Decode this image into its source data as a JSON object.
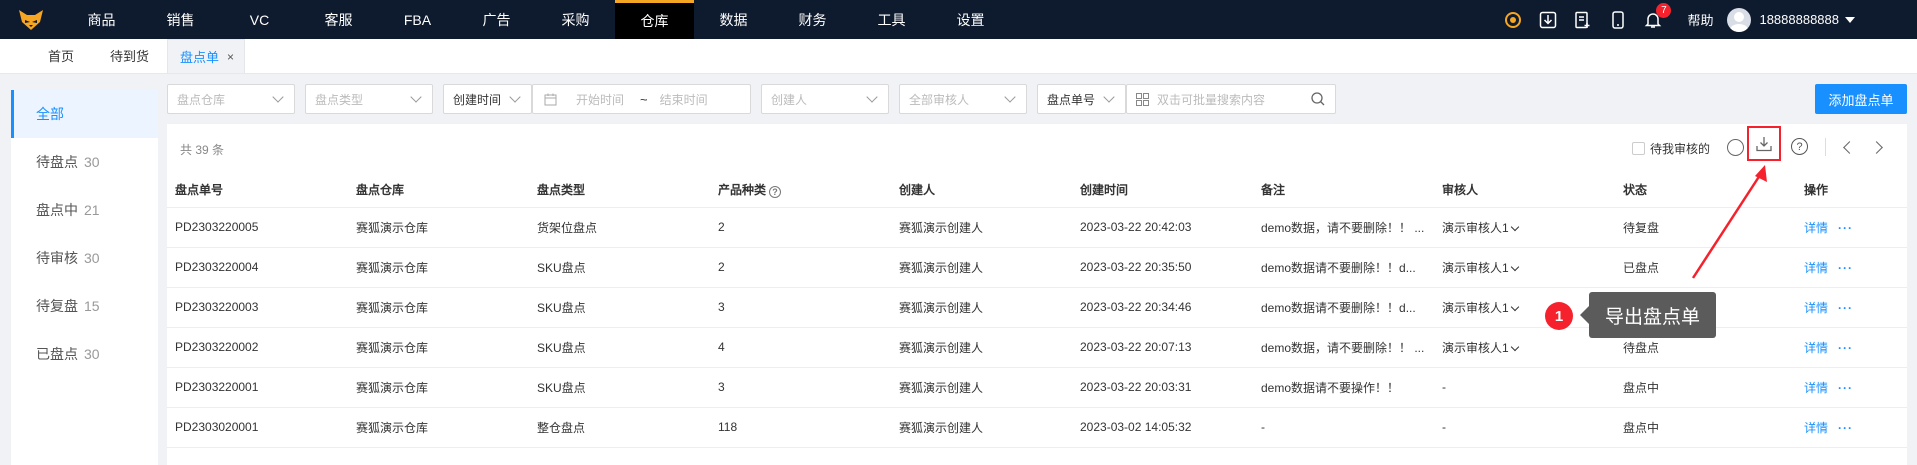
{
  "topnav": {
    "items": [
      {
        "label": "商品",
        "active": false
      },
      {
        "label": "销售",
        "active": false
      },
      {
        "label": "VC",
        "active": false
      },
      {
        "label": "客服",
        "active": false
      },
      {
        "label": "FBA",
        "active": false
      },
      {
        "label": "广告",
        "active": false
      },
      {
        "label": "采购",
        "active": false
      },
      {
        "label": "仓库",
        "active": true
      },
      {
        "label": "数据",
        "active": false
      },
      {
        "label": "财务",
        "active": false
      },
      {
        "label": "工具",
        "active": false
      },
      {
        "label": "设置",
        "active": false
      }
    ],
    "notification_count": "7",
    "help_label": "帮助",
    "username": "18888888888"
  },
  "tabs": {
    "home": "首页",
    "pending_arrival": "待到货",
    "inventory_check": "盘点单",
    "close": "×"
  },
  "sidebar": {
    "items": [
      {
        "label": "全部",
        "count": ""
      },
      {
        "label": "待盘点",
        "count": "30"
      },
      {
        "label": "盘点中",
        "count": "21"
      },
      {
        "label": "待审核",
        "count": "30"
      },
      {
        "label": "待复盘",
        "count": "15"
      },
      {
        "label": "已盘点",
        "count": "30"
      }
    ]
  },
  "filters": {
    "warehouse_placeholder": "盘点仓库",
    "type_placeholder": "盘点类型",
    "time_field": "创建时间",
    "start_placeholder": "开始时间",
    "range_sep": "~",
    "end_placeholder": "结束时间",
    "creator_placeholder": "创建人",
    "reviewer_placeholder": "全部审核人",
    "search_field": "盘点单号",
    "search_placeholder": "双击可批量搜索内容",
    "add_button": "添加盘点单"
  },
  "toolbar": {
    "total": "共 39 条",
    "pending_my_review": "待我审核的"
  },
  "table": {
    "headers": [
      "盘点单号",
      "盘点仓库",
      "盘点类型",
      "产品种类",
      "创建人",
      "创建时间",
      "备注",
      "审核人",
      "状态",
      "操作"
    ],
    "rows": [
      {
        "id": "PD2303220005",
        "warehouse": "赛狐演示仓库",
        "type": "货架位盘点",
        "kinds": "2",
        "creator": "赛狐演示创建人",
        "created": "2023-03-22 20:42:03",
        "note": "demo数据，请不要删除！！ ...",
        "reviewer": "演示审核人1",
        "reviewer_dropdown": true,
        "status": "待复盘",
        "detail": "详情",
        "more": "···"
      },
      {
        "id": "PD2303220004",
        "warehouse": "赛狐演示仓库",
        "type": "SKU盘点",
        "kinds": "2",
        "creator": "赛狐演示创建人",
        "created": "2023-03-22 20:35:50",
        "note": "demo数据请不要删除！！d...",
        "reviewer": "演示审核人1",
        "reviewer_dropdown": true,
        "status": "已盘点",
        "detail": "详情",
        "more": "···"
      },
      {
        "id": "PD2303220003",
        "warehouse": "赛狐演示仓库",
        "type": "SKU盘点",
        "kinds": "3",
        "creator": "赛狐演示创建人",
        "created": "2023-03-22 20:34:46",
        "note": "demo数据请不要删除！！d...",
        "reviewer": "演示审核人1",
        "reviewer_dropdown": true,
        "status": "",
        "detail": "详情",
        "more": "···"
      },
      {
        "id": "PD2303220002",
        "warehouse": "赛狐演示仓库",
        "type": "SKU盘点",
        "kinds": "4",
        "creator": "赛狐演示创建人",
        "created": "2023-03-22 20:07:13",
        "note": "demo数据，请不要删除！！ ...",
        "reviewer": "演示审核人1",
        "reviewer_dropdown": true,
        "status": "待盘点",
        "detail": "详情",
        "more": "···"
      },
      {
        "id": "PD2303220001",
        "warehouse": "赛狐演示仓库",
        "type": "SKU盘点",
        "kinds": "3",
        "creator": "赛狐演示创建人",
        "created": "2023-03-22 20:03:31",
        "note": "demo数据请不要操作！！",
        "reviewer": "-",
        "reviewer_dropdown": false,
        "status": "盘点中",
        "detail": "详情",
        "more": "···"
      },
      {
        "id": "PD2303020001",
        "warehouse": "赛狐演示仓库",
        "type": "整仓盘点",
        "kinds": "118",
        "creator": "赛狐演示创建人",
        "created": "2023-03-02 14:05:32",
        "note": "-",
        "reviewer": "-",
        "reviewer_dropdown": false,
        "status": "盘点中",
        "detail": "详情",
        "more": "···"
      }
    ]
  },
  "callout": {
    "step": "1",
    "text": "导出盘点单"
  },
  "colors": {
    "nav_bg": "#0e1a2d",
    "accent": "#1890ff",
    "highlight_red": "#f5222d",
    "logo_orange": "#f5a623"
  }
}
